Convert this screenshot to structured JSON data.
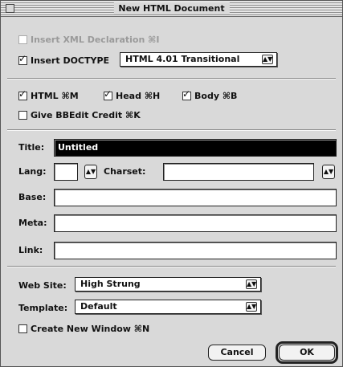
{
  "window": {
    "title": "New HTML Document"
  },
  "options": {
    "xml_decl": {
      "label": "Insert XML Declaration",
      "shortcut": "⌘I",
      "checked": false,
      "enabled": false
    },
    "doctype": {
      "label": "Insert DOCTYPE",
      "checked": true,
      "selected": "HTML 4.01 Transitional"
    }
  },
  "tags": {
    "html": {
      "label": "HTML",
      "shortcut": "⌘M",
      "checked": true
    },
    "head": {
      "label": "Head",
      "shortcut": "⌘H",
      "checked": true
    },
    "body": {
      "label": "Body",
      "shortcut": "⌘B",
      "checked": true
    },
    "credit": {
      "label": "Give BBEdit Credit",
      "shortcut": "⌘K",
      "checked": false
    }
  },
  "fields": {
    "title": {
      "label": "Title:",
      "value": "Untitled"
    },
    "lang": {
      "label": "Lang:",
      "value": ""
    },
    "charset": {
      "label": "Charset:",
      "value": ""
    },
    "base": {
      "label": "Base:",
      "value": ""
    },
    "meta": {
      "label": "Meta:",
      "value": ""
    },
    "link": {
      "label": "Link:",
      "value": ""
    }
  },
  "site": {
    "website": {
      "label": "Web Site:",
      "selected": "High Strung"
    },
    "template": {
      "label": "Template:",
      "selected": "Default"
    },
    "new_window": {
      "label": "Create New Window",
      "shortcut": "⌘N",
      "checked": false
    }
  },
  "buttons": {
    "cancel": "Cancel",
    "ok": "OK"
  },
  "glyphs": {
    "check": "✓",
    "updown": "▲▼"
  }
}
